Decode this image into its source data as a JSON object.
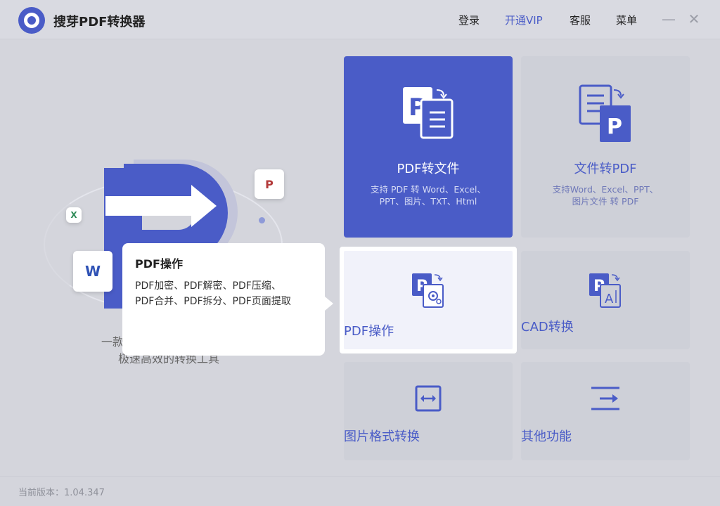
{
  "app": {
    "title": "搜芽PDF转换器"
  },
  "header": {
    "nav": [
      {
        "label": "登录"
      },
      {
        "label": "开通VIP"
      },
      {
        "label": "客服"
      },
      {
        "label": "菜单"
      }
    ],
    "minimize": "—",
    "close": "✕"
  },
  "hero": {
    "tagline_line1": "一款支持多格式",
    "tagline_line2": "极速高效的转换工具",
    "icons": {
      "excel": "X",
      "word": "W",
      "pdf": "P"
    }
  },
  "cards": [
    {
      "title": "PDF转文件",
      "desc_line1": "支持 PDF 转 Word、Excel、",
      "desc_line2": "PPT、图片、TXT、Html",
      "icon": "pdf-to-file-icon"
    },
    {
      "title": "文件转PDF",
      "desc_line1": "支持Word、Excel、PPT、",
      "desc_line2": "图片文件 转 PDF",
      "icon": "file-to-pdf-icon"
    },
    {
      "title": "PDF操作",
      "icon": "pdf-operation-icon"
    },
    {
      "title": "CAD转换",
      "icon": "cad-convert-icon"
    },
    {
      "title": "图片格式转换",
      "icon": "image-convert-icon"
    },
    {
      "title": "其他功能",
      "icon": "other-functions-icon"
    }
  ],
  "tooltip": {
    "title": "PDF操作",
    "line1": "PDF加密、PDF解密、PDF压缩、",
    "line2": "PDF合并、PDF拆分、PDF页面提取"
  },
  "footer": {
    "version": "当前版本：1.04.347"
  },
  "colors": {
    "accent": "#4a5cc7",
    "background": "#d4d5dc"
  }
}
